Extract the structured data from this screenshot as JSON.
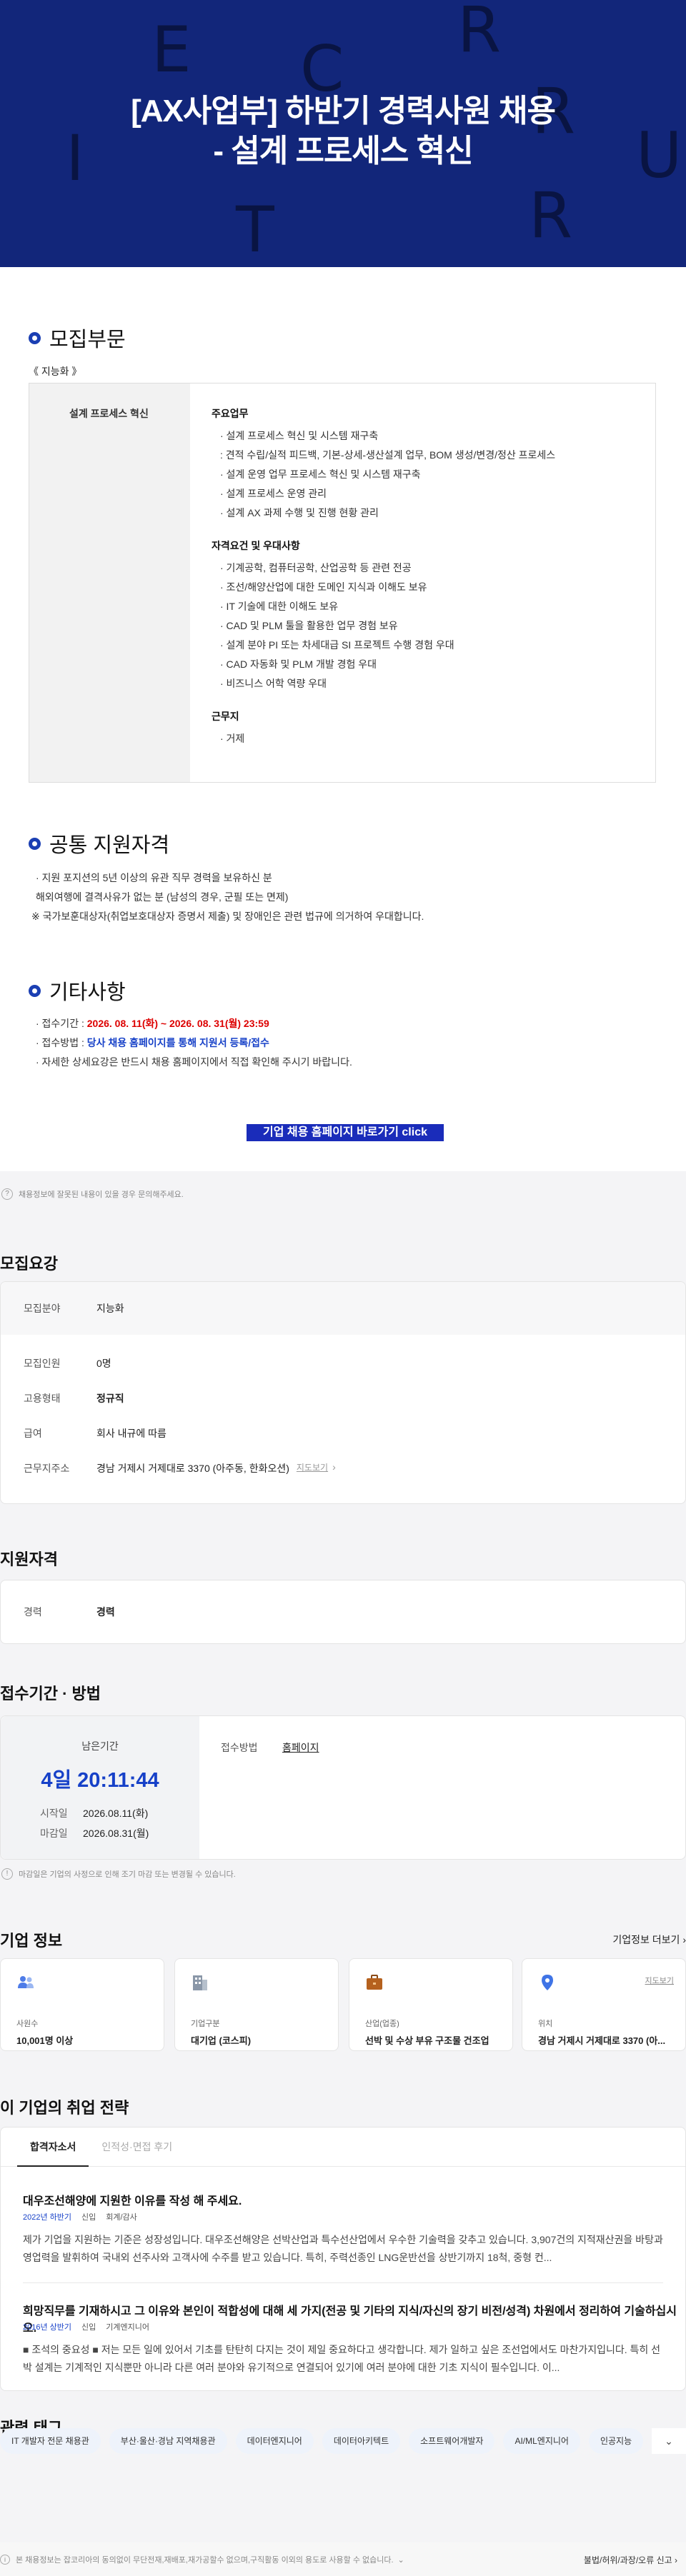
{
  "hero": {
    "title_line1": "[AX사업부] 하반기 경력사원 채용",
    "title_line2": "- 설계 프로세스 혁신",
    "bg_letters": [
      "E",
      "C",
      "R",
      "R",
      "U",
      "I",
      "T",
      "R"
    ]
  },
  "recruit_section": {
    "heading": "모집부문",
    "category_tag": "《 지능화 》",
    "position_name": "설계 프로세스 혁신",
    "duties_heading": "주요업무",
    "duties": [
      "· 설계 프로세스 혁신 및 시스템 재구축",
      "  : 견적 수립/실적 피드백, 기본-상세-생산설계 업무, BOM 생성/변경/정산 프로세스",
      "· 설계 운영 업무 프로세스 혁신 및 시스템 재구축",
      "· 설계 프로세스 운영 관리",
      "· 설계 AX 과제 수행 및 진행 현황 관리"
    ],
    "qual_heading": "자격요건 및 우대사항",
    "quals": [
      "· 기계공학, 컴퓨터공학, 산업공학 등 관련 전공",
      "· 조선/해양산업에 대한 도메인 지식과 이해도 보유",
      "· IT 기술에 대한 이해도 보유",
      "· CAD 및 PLM 툴을 활용한 업무 경험 보유",
      "· 설계 분야 PI 또는 차세대급 SI 프로젝트 수행 경험 우대",
      "· CAD 자동화 및 PLM 개발 경험 우대",
      "· 비즈니스 어학 역량 우대"
    ],
    "location_heading": "근무지",
    "location": "· 거제"
  },
  "common_section": {
    "heading": "공통 지원자격",
    "lines": [
      "· 지원 포지션의 5년 이상의 유관 직무 경력을 보유하신 분",
      "  해외여행에 결격사유가 없는 분 (남성의 경우, 군필 또는 면제)",
      "※ 국가보훈대상자(취업보호대상자 증명서 제출) 및 장애인은 관련 법규에 의거하여 우대합니다."
    ]
  },
  "etc_section": {
    "heading": "기타사항",
    "period_label": "· 접수기간 : ",
    "period_value": "2026. 08. 11(화) ~ 2026. 08. 31(월) 23:59",
    "method_label": "· 접수방법 : ",
    "method_value": "당사 채용 홈페이지를 통해 지원서 등록/접수",
    "detail_line": "· 자세한 상세요강은 반드시 채용 홈페이지에서 직접 확인해 주시기 바랍니다.",
    "homepage_button": "기업 채용 홈페이지 바로가기 click"
  },
  "report_notice": "채용정보에 잘못된 내용이 있을 경우 문의해주세요.",
  "summary": {
    "heading": "모집요강",
    "field_label": "모집분야",
    "field_value": "지능화",
    "headcount_label": "모집인원",
    "headcount_value": "0명",
    "type_label": "고용형태",
    "type_value": "정규직",
    "salary_label": "급여",
    "salary_value": "회사 내규에 따름",
    "address_label": "근무지주소",
    "address_value": "경남 거제시 거제대로 3370 (아주동, 한화오션)",
    "map_link": "지도보기"
  },
  "qualification": {
    "heading": "지원자격",
    "career_label": "경력",
    "career_value": "경력"
  },
  "apply": {
    "heading": "접수기간 · 방법",
    "remain_label": "남은기간",
    "remain_value": "4일 20:11:44",
    "start_label": "시작일",
    "start_value": "2026.08.11(화)",
    "end_label": "마감일",
    "end_value": "2026.08.31(월)",
    "method_label": "접수방법",
    "method_value": "홈페이지",
    "notice": "마감일은 기업의 사정으로 인해 조기 마감 또는 변경될 수 있습니다."
  },
  "company": {
    "heading": "기업 정보",
    "more": "기업정보 더보기",
    "cards": [
      {
        "icon": "people-icon",
        "label": "사원수",
        "value": "10,001명 이상"
      },
      {
        "icon": "building-icon",
        "label": "기업구분",
        "value": "대기업 (코스피)"
      },
      {
        "icon": "briefcase-icon",
        "label": "산업(업종)",
        "value": "선박 및 수상 부유 구조물 건조업"
      },
      {
        "icon": "location-pin-icon",
        "label": "위치",
        "value": "경남 거제시 거제대로 3370 (아...",
        "link": "지도보기"
      }
    ]
  },
  "strategy": {
    "heading": "이 기업의 취업 전략",
    "tabs": [
      "합격자소서",
      "인적성·면접 후기"
    ],
    "articles": [
      {
        "title": "대우조선해양에 지원한 이유를 작성 해 주세요.",
        "year": "2022년 하반기",
        "type": "신입",
        "role": "회계/감사",
        "body": "제가 기업을 지원하는 기준은 성장성입니다. 대우조선해양은 선박산업과 특수선산업에서 우수한 기술력을 갖추고 있습니다. 3,907건의 지적재산권을 바탕과 영업력을 발휘하여 국내외 선주사와 고객사에 수주를 받고 있습니다. 특히, 주력선종인 LNG운반선을 상반기까지 18척, 중형 컨..."
      },
      {
        "title": "희망직무를 기재하시고 그 이유와 본인이 적합성에 대해 세 가지(전공 및 기타의 지식/자신의 장기 비전/성격) 차원에서 정리하여 기술하십시오.",
        "year": "2016년 상반기",
        "type": "신입",
        "role": "기계엔지니어",
        "body": "■ 조석의 중요성 ■ 저는 모든 일에 있어서 기초를 탄탄히 다지는 것이 제일 중요하다고 생각합니다. 제가 일하고 싶은 조선업에서도 마찬가지입니다. 특히 선박 설계는 기계적인 지식뿐만 아니라 다른 여러 분야와 유기적으로 연결되어 있기에 여러 분야에 대한 기초 지식이 필수입니다. 이..."
      }
    ]
  },
  "related_tags": {
    "heading": "관련 태그",
    "tags": [
      "IT 개발자 전문 채용관",
      "부산·울산·경남 지역채용관",
      "데이터엔지니어",
      "데이터아키텍트",
      "소프트웨어개발자",
      "AI/ML엔지니어",
      "인공지능"
    ]
  },
  "footer": {
    "notice": "본 채용정보는 잡코리아의 동의없이 무단전재,재배포,재가공할수 없으며,구직활동 이외의 용도로 사용할 수 없습니다.",
    "report": "불법/허위/과장/오류 신고"
  },
  "colors": {
    "hero_bg": "#12267a",
    "accent_blue": "#1741c8",
    "red": "#dd0000",
    "button_bg": "#1a2cba"
  }
}
